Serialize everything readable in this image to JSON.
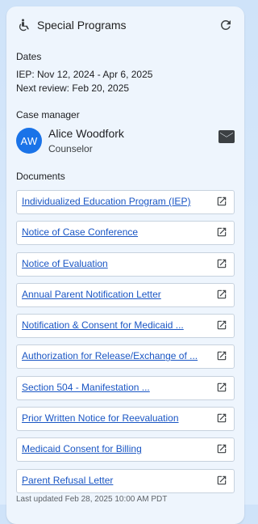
{
  "header": {
    "title": "Special Programs",
    "icon": "accessibility-icon",
    "refresh_icon": "refresh-icon"
  },
  "dates": {
    "label": "Dates",
    "iep": "IEP: Nov 12, 2024 - Apr 6, 2025",
    "next_review": "Next review: Feb 20, 2025"
  },
  "case_manager": {
    "label": "Case manager",
    "initials": "AW",
    "name": "Alice Woodfork",
    "role": "Counselor",
    "avatar_color": "#1a73e8",
    "mail_icon": "mail-icon"
  },
  "documents": {
    "label": "Documents",
    "items": [
      "Individualized Education Program (IEP)",
      "Notice of Case Conference",
      "Notice of Evaluation",
      "Annual Parent Notification Letter",
      "Notification & Consent for Medicaid ...",
      "Authorization for Release/Exchange of ...",
      "Section 504 - Manifestation ...",
      "Prior Written Notice for Reevaluation",
      "Medicaid Consent for Billing",
      "Parent Refusal Letter"
    ],
    "link_color": "#1a56c4",
    "open_icon": "open-in-new-icon"
  },
  "footer": {
    "last_updated": "Last updated Feb 28, 2025 10:00 AM PDT"
  }
}
